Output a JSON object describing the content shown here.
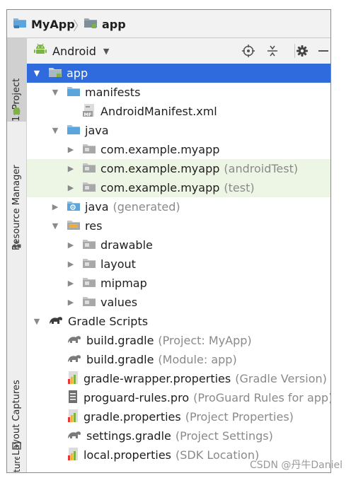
{
  "breadcrumb": {
    "project": "MyApp",
    "module": "app"
  },
  "side_tabs": {
    "project": "1: Project",
    "resource_manager": "Resource Manager",
    "layout_captures": "Layout Captures",
    "structure": "ture"
  },
  "toolbar": {
    "view_mode": "Android",
    "icons": [
      "locate-icon",
      "collapse-all-icon",
      "gear-icon",
      "hide-icon"
    ]
  },
  "tree": [
    {
      "label": "app",
      "hint": "",
      "icon": "module-folder-icon",
      "arrow": "expanded"
    },
    {
      "label": "manifests",
      "hint": "",
      "icon": "folder-icon",
      "arrow": "expanded"
    },
    {
      "label": "AndroidManifest.xml",
      "hint": "",
      "icon": "manifest-file-icon",
      "arrow": "none"
    },
    {
      "label": "java",
      "hint": "",
      "icon": "folder-icon",
      "arrow": "expanded"
    },
    {
      "label": "com.example.myapp",
      "hint": "",
      "icon": "package-icon",
      "arrow": "collapsed"
    },
    {
      "label": "com.example.myapp",
      "hint": "(androidTest)",
      "icon": "package-icon",
      "arrow": "collapsed"
    },
    {
      "label": "com.example.myapp",
      "hint": "(test)",
      "icon": "package-icon",
      "arrow": "collapsed"
    },
    {
      "label": "java",
      "hint": "(generated)",
      "icon": "generated-folder-icon",
      "arrow": "collapsed"
    },
    {
      "label": "res",
      "hint": "",
      "icon": "res-folder-icon",
      "arrow": "expanded"
    },
    {
      "label": "drawable",
      "hint": "",
      "icon": "folder-icon",
      "arrow": "collapsed"
    },
    {
      "label": "layout",
      "hint": "",
      "icon": "folder-icon",
      "arrow": "collapsed"
    },
    {
      "label": "mipmap",
      "hint": "",
      "icon": "folder-icon",
      "arrow": "collapsed"
    },
    {
      "label": "values",
      "hint": "",
      "icon": "folder-icon",
      "arrow": "collapsed"
    },
    {
      "label": "Gradle Scripts",
      "hint": "",
      "icon": "gradle-icon",
      "arrow": "expanded"
    },
    {
      "label": "build.gradle",
      "hint": "(Project: MyApp)",
      "icon": "gradle-file-icon",
      "arrow": "none"
    },
    {
      "label": "build.gradle",
      "hint": "(Module: app)",
      "icon": "gradle-file-icon",
      "arrow": "none"
    },
    {
      "label": "gradle-wrapper.properties",
      "hint": "(Gradle Version)",
      "icon": "properties-file-icon",
      "arrow": "none"
    },
    {
      "label": "proguard-rules.pro",
      "hint": "(ProGuard Rules for app)",
      "icon": "text-file-icon",
      "arrow": "none"
    },
    {
      "label": "gradle.properties",
      "hint": "(Project Properties)",
      "icon": "properties-file-icon",
      "arrow": "none"
    },
    {
      "label": "settings.gradle",
      "hint": "(Project Settings)",
      "icon": "gradle-file-icon",
      "arrow": "none"
    },
    {
      "label": "local.properties",
      "hint": "(SDK Location)",
      "icon": "properties-file-icon",
      "arrow": "none"
    }
  ],
  "watermark": "CSDN @丹牛Daniel",
  "colors": {
    "selection": "#2f6bdd",
    "test_tint": "#edf5e4",
    "hint_text": "#8a8a8a",
    "folder_blue": "#5aa6dc",
    "android_green": "#7cb342"
  }
}
